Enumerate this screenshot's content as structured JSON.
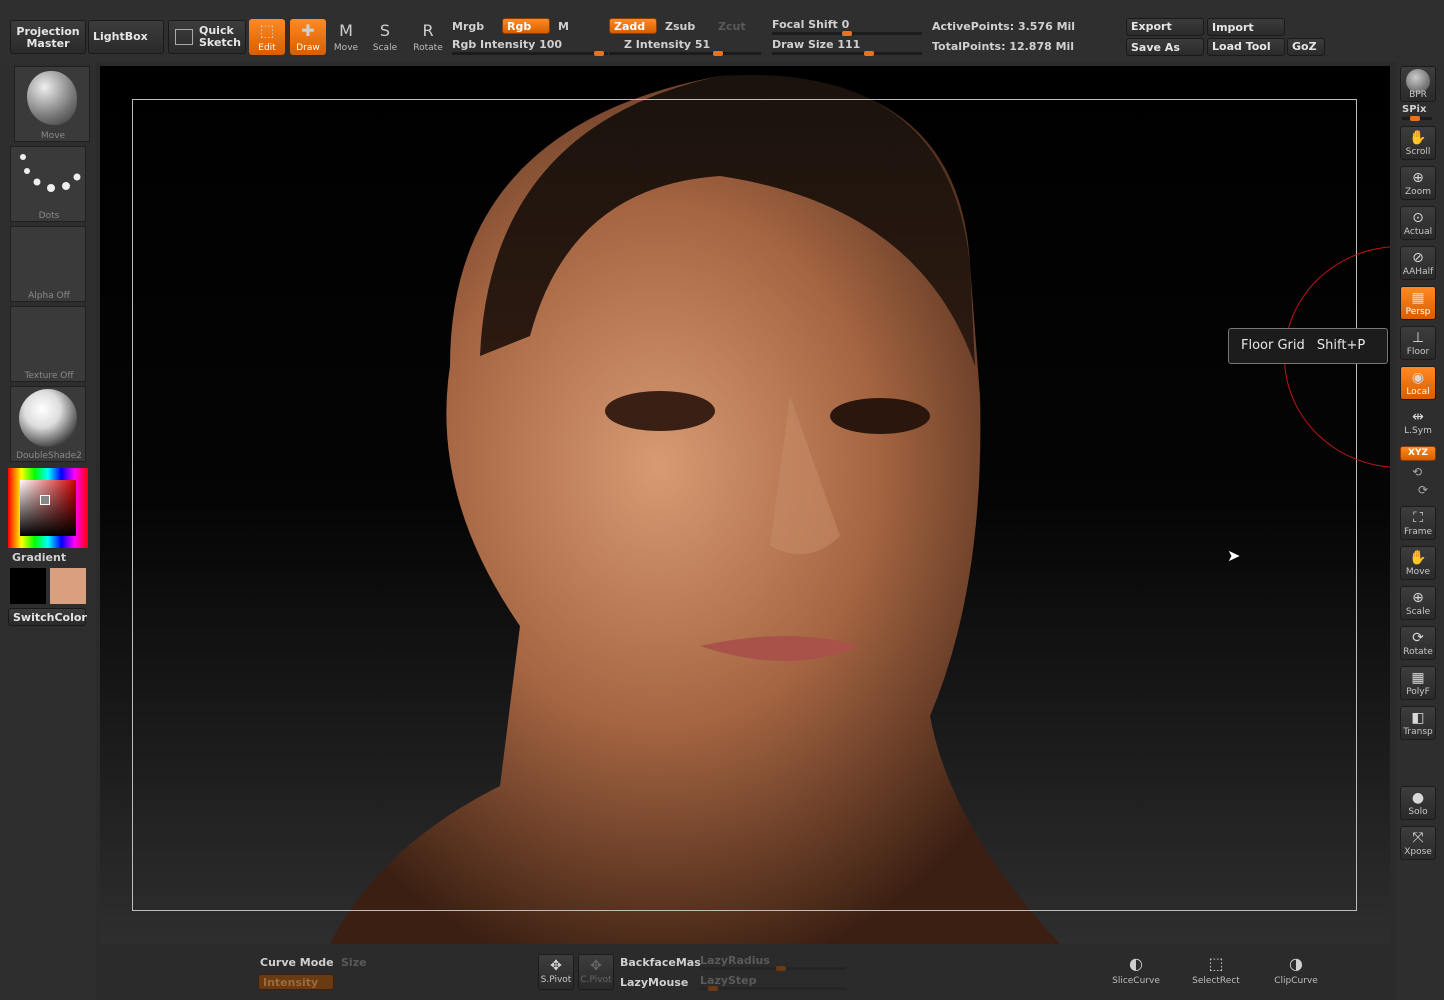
{
  "top": {
    "projection_master": "Projection Master",
    "lightbox": "LightBox",
    "quick_sketch": "Quick Sketch",
    "edit": "Edit",
    "draw": "Draw",
    "move": "Move",
    "scale": "Scale",
    "rotate": "Rotate",
    "mrgb": "Mrgb",
    "rgb": "Rgb",
    "m": "M",
    "rgb_intensity": "Rgb Intensity 100",
    "zadd": "Zadd",
    "zsub": "Zsub",
    "zcut": "Zcut",
    "z_intensity": "Z Intensity 51",
    "focal_shift": "Focal Shift 0",
    "draw_size": "Draw Size 111",
    "active_points": "ActivePoints: 3.576  Mil",
    "total_points": "TotalPoints: 12.878  Mil",
    "export": "Export",
    "import": "Import",
    "save_as": "Save As",
    "load_tool": "Load Tool",
    "goz": "GoZ"
  },
  "left": {
    "brush": "Move",
    "stroke": "Dots",
    "alpha": "Alpha  Off",
    "texture": "Texture  Off",
    "material": "DoubleShade2",
    "gradient": "Gradient",
    "switchcolor": "SwitchColor",
    "colors": {
      "main": "#000000",
      "secondary": "#d9a080"
    }
  },
  "right": {
    "bpr": "BPR",
    "spix": "SPix",
    "items": [
      {
        "label": "Scroll",
        "icon": "hand-icon"
      },
      {
        "label": "Zoom",
        "icon": "zoom-icon"
      },
      {
        "label": "Actual",
        "icon": "actual-icon"
      },
      {
        "label": "AAHalf",
        "icon": "aahalf-icon"
      },
      {
        "label": "Persp",
        "icon": "perspective-icon"
      },
      {
        "label": "Floor",
        "icon": "floor-icon"
      },
      {
        "label": "Local",
        "icon": "local-icon"
      },
      {
        "label": "L.Sym",
        "icon": "symmetry-icon"
      },
      {
        "label": "Frame",
        "icon": "frame-icon"
      },
      {
        "label": "Move",
        "icon": "move-icon"
      },
      {
        "label": "Scale",
        "icon": "scale-icon"
      },
      {
        "label": "Rotate",
        "icon": "rotate-icon"
      },
      {
        "label": "PolyF",
        "icon": "polyframe-icon"
      },
      {
        "label": "Transp",
        "icon": "transparency-icon"
      },
      {
        "label": "Solo",
        "icon": "solo-icon"
      },
      {
        "label": "Xpose",
        "icon": "xpose-icon"
      }
    ],
    "xyz": "XYZ"
  },
  "tooltip": {
    "text": "Floor Grid",
    "shortcut": "Shift+P"
  },
  "bottom": {
    "curve_mode": "Curve Mode",
    "size": "Size",
    "intensity": "Intensity",
    "spivot": "S.Pivot",
    "cpivot": "C.Pivot",
    "backfacemask": "BackfaceMas",
    "lazymouse": "LazyMouse",
    "lazyradius": "LazyRadius",
    "lazystep": "LazyStep",
    "slicecurve": "SliceCurve",
    "selectrect": "SelectRect",
    "clipcurve": "ClipCurve"
  }
}
